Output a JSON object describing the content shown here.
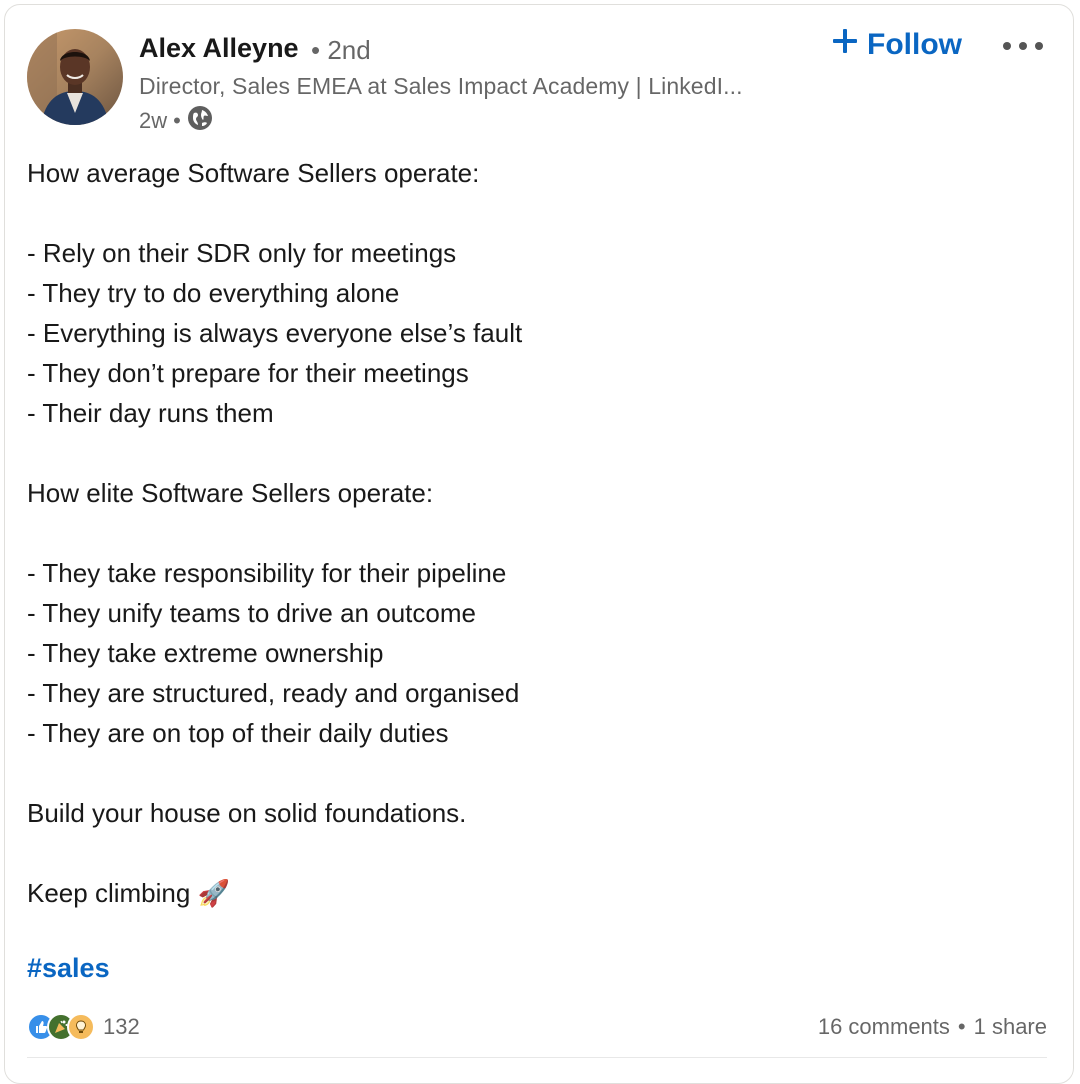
{
  "author": {
    "name": "Alex Alleyne",
    "degree": "2nd",
    "headline": "Director, Sales EMEA at Sales Impact Academy | LinkedI...",
    "time": "2w",
    "visibility_icon": "globe-icon"
  },
  "actions": {
    "follow_label": "Follow",
    "more_icon": "more-options-icon"
  },
  "post": {
    "lines": [
      "How average Software Sellers operate:",
      "",
      "- Rely on their SDR only for meetings",
      "- They try to do everything alone",
      "- Everything is always everyone else’s fault",
      "- They don’t prepare for their meetings",
      "- Their day runs them",
      "",
      "How elite Software Sellers operate:",
      "",
      "- They take responsibility for their pipeline",
      "- They unify teams to drive an outcome",
      "- They take extreme ownership",
      "- They are structured, ready and organised",
      "- They are on top of their daily duties",
      "",
      "Build your house on solid foundations.",
      "",
      "Keep climbing 🚀"
    ],
    "hashtag": "#sales"
  },
  "social": {
    "reactions": [
      "like-reaction-icon",
      "celebrate-reaction-icon",
      "insightful-reaction-icon"
    ],
    "reaction_count": "132",
    "comments": "16 comments",
    "separator": "•",
    "shares": "1 share"
  },
  "colors": {
    "accent": "#0a66c2",
    "secondary_text": "#666666"
  }
}
